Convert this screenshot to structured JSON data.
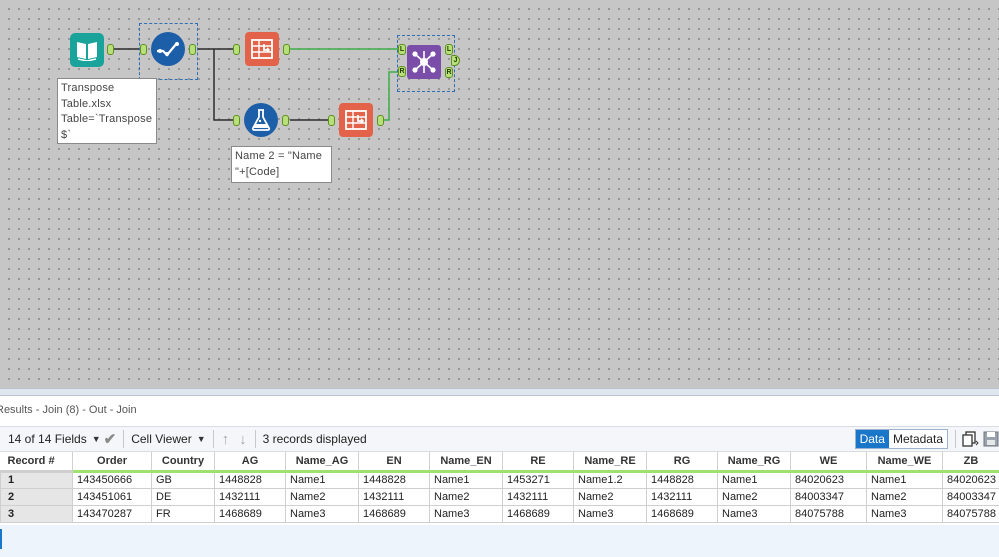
{
  "canvas": {
    "annotations": {
      "input": "Transpose\nTable.xlsx\nTable=`Transpose\n$`",
      "formula": "Name 2 = \"Name\n\"+[Code]"
    },
    "anchors": {
      "join_left": "L",
      "join_right": "R",
      "join_j": "J",
      "join_out_l": "L",
      "join_out_r": "R"
    },
    "tools": [
      {
        "name": "Input Data",
        "icon": "book-icon",
        "color": "#1aa39a"
      },
      {
        "name": "Select",
        "icon": "select-checkmark-icon",
        "color": "#1d5ea8"
      },
      {
        "name": "Transpose",
        "icon": "transpose-icon",
        "color": "#e2634a"
      },
      {
        "name": "Formula",
        "icon": "flask-icon",
        "color": "#1d5ea8"
      },
      {
        "name": "Transpose",
        "icon": "transpose-icon",
        "color": "#e2634a"
      },
      {
        "name": "Join",
        "icon": "join-network-icon",
        "color": "#7a4ea8"
      }
    ]
  },
  "results": {
    "title": "Results - Join (8) - Out - Join",
    "fields_label": "14 of 14 Fields",
    "cell_viewer_label": "Cell Viewer",
    "records_label": "3 records displayed",
    "data_label": "Data",
    "metadata_label": "Metadata",
    "columns": [
      "Record #",
      "Order",
      "Country",
      "AG",
      "Name_AG",
      "EN",
      "Name_EN",
      "RE",
      "Name_RE",
      "RG",
      "Name_RG",
      "WE",
      "Name_WE",
      "ZB"
    ],
    "rows": [
      [
        "1",
        "143450666",
        "GB",
        "1448828",
        "Name1",
        "1448828",
        "Name1",
        "1453271",
        "Name1.2",
        "1448828",
        "Name1",
        "84020623",
        "Name1",
        "84020623"
      ],
      [
        "2",
        "143451061",
        "DE",
        "1432111",
        "Name2",
        "1432111",
        "Name2",
        "1432111",
        "Name2",
        "1432111",
        "Name2",
        "84003347",
        "Name2",
        "84003347"
      ],
      [
        "3",
        "143470287",
        "FR",
        "1468689",
        "Name3",
        "1468689",
        "Name3",
        "1468689",
        "Name3",
        "1468689",
        "Name3",
        "84075788",
        "Name3",
        "84075788"
      ]
    ]
  }
}
